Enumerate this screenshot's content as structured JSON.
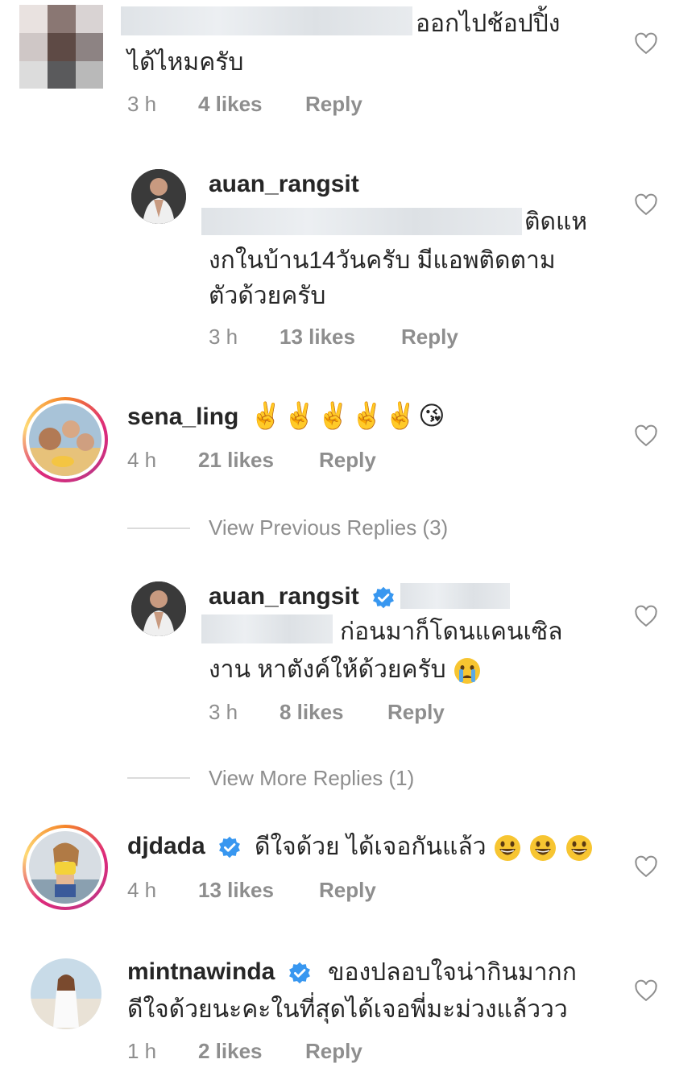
{
  "comments": [
    {
      "text_line1": "ออกไปช้อปปิ้ง",
      "text_line2": "ได้ไหมครับ",
      "time": "3 h",
      "likes": "4 likes",
      "reply": "Reply"
    },
    {
      "username": "auan_rangsit",
      "text_line1": "ติดแห",
      "text_line2": "งกในบ้าน14วันครับ มีแอพติดตาม",
      "text_line3": "ตัวด้วยครับ",
      "time": "3 h",
      "likes": "13 likes",
      "reply": "Reply"
    },
    {
      "username": "sena_ling",
      "emojis": "✌️✌️✌️✌️✌️😘",
      "time": "4 h",
      "likes": "21 likes",
      "reply": "Reply"
    },
    {
      "username": "auan_rangsit",
      "text_line1": "ก่อนมาก็โดนแคนเซิล",
      "text_line2": "งาน หาตังค์ให้ด้วยครับ",
      "time": "3 h",
      "likes": "8 likes",
      "reply": "Reply"
    },
    {
      "username": "djdada",
      "text": "ดีใจด้วย ได้เจอกันแล้ว",
      "time": "4 h",
      "likes": "13 likes",
      "reply": "Reply"
    },
    {
      "username": "mintnawinda",
      "text_line1": "ของปลอบใจน่ากินมากก",
      "text_line2": "ดีใจด้วยนะคะในที่สุดได้เจอพี่มะม่วงแล้ววว",
      "time": "1 h",
      "likes": "2 likes",
      "reply": "Reply"
    }
  ],
  "view_previous_replies": "View Previous Replies (3)",
  "view_more_replies": "View More Replies (1)",
  "colors": {
    "text": "#262626",
    "meta": "#8e8e8e",
    "verified": "#3897f0",
    "divider": "#dbdbdb"
  }
}
